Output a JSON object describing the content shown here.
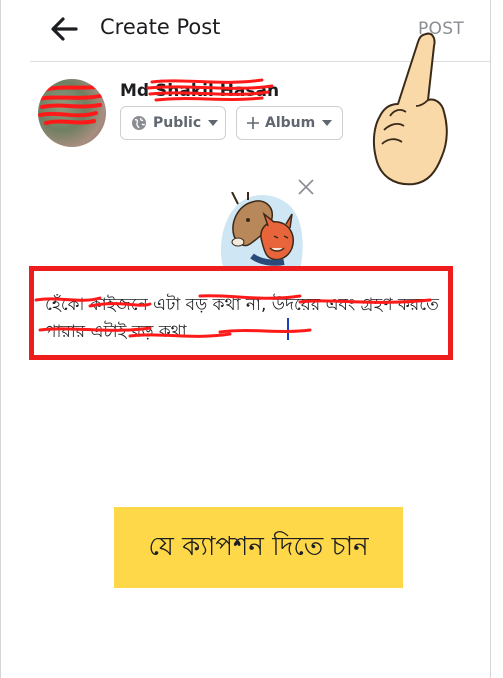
{
  "header": {
    "title": "Create Post",
    "post_label": "POST"
  },
  "user": {
    "name": "Md Shakil Hasan",
    "privacy_label": "Public",
    "album_label": "Album"
  },
  "composer": {
    "text": "হেঁকো কাইজনে এটা বড় কথা না, উদয়ের এবং গ্রহণ করতে পারার এটাই বড় কথা"
  },
  "caption": {
    "text": "যে ক্যাপশন দিতে চান"
  },
  "icons": {
    "back": "arrow-left-icon",
    "privacy": "globe-icon",
    "album": "plus-icon",
    "dropdown": "caret-down-icon",
    "close": "close-icon",
    "pointer": "pointing-hand-icon"
  },
  "colors": {
    "highlight_frame": "#ee1c1c",
    "caption_bg": "#ffd84a",
    "scribble": "#ff1a1a",
    "cursor": "#1a3fbf"
  }
}
